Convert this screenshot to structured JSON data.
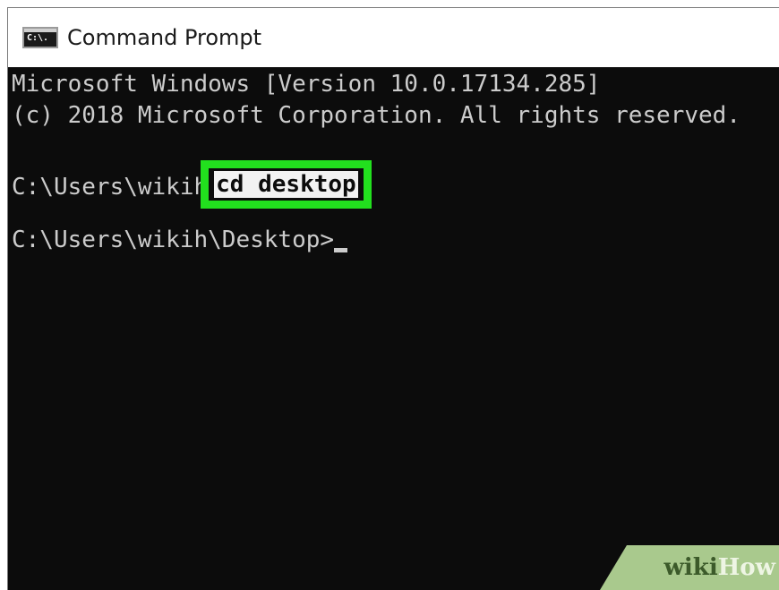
{
  "window": {
    "title": "Command Prompt",
    "icon_label": "C:\\."
  },
  "console": {
    "line1": "Microsoft Windows [Version 10.0.17134.285]",
    "line2": "(c) 2018 Microsoft Corporation. All rights reserved.",
    "prompt1": "C:\\Users\\wikih",
    "command": "cd desktop",
    "prompt2": "C:\\Users\\wikih\\Desktop>"
  },
  "watermark": {
    "wiki": "wiki",
    "how": "How"
  },
  "colors": {
    "console_bg": "#0c0c0c",
    "console_text": "#cccccc",
    "highlight_border": "#22e01e"
  }
}
